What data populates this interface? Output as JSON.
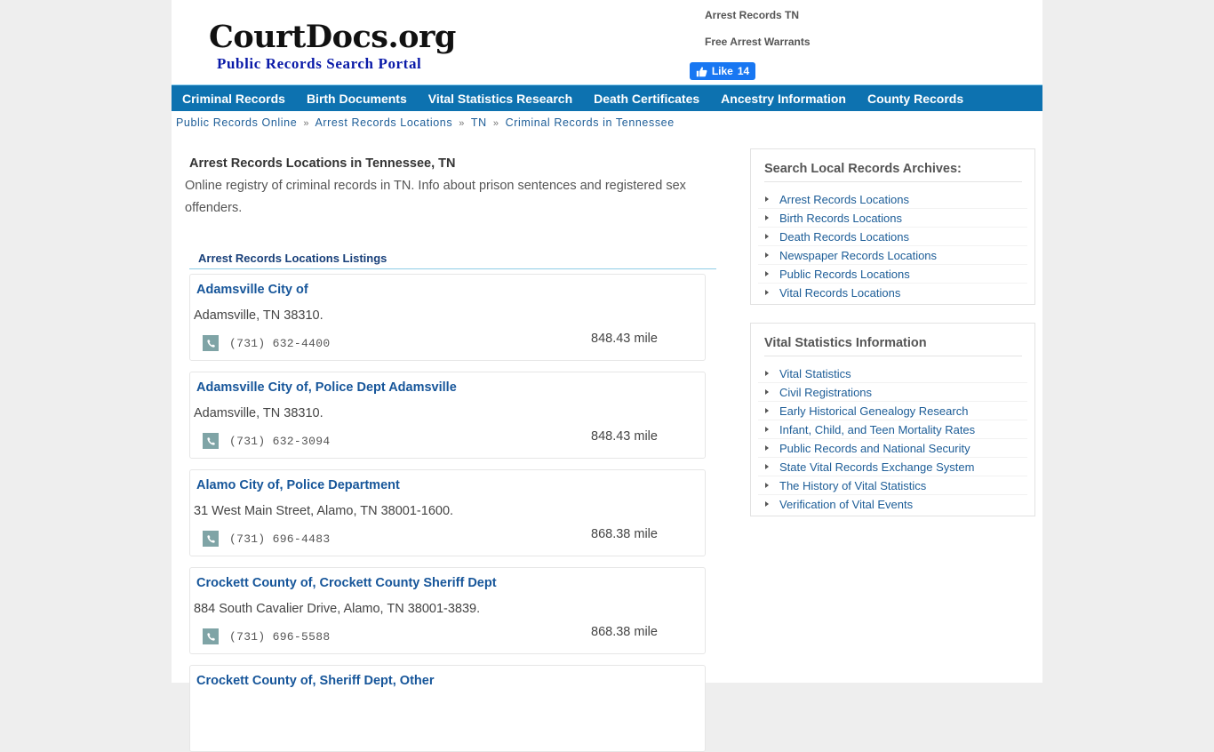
{
  "header": {
    "logo_title": "CourtDocs.org",
    "logo_subtitle": "Public Records Search Portal",
    "top_links": [
      "Arrest Records TN",
      "Free Arrest Warrants"
    ],
    "fb_like": {
      "label": "Like",
      "count": "14",
      "color": "#1877f2"
    }
  },
  "nav": {
    "color": "#0d72b0",
    "items": [
      "Criminal Records",
      "Birth Documents",
      "Vital Statistics Research",
      "Death Certificates",
      "Ancestry Information",
      "County Records"
    ]
  },
  "breadcrumb": {
    "separator": "»",
    "items": [
      "Public Records Online",
      "Arrest Records Locations",
      "TN",
      "Criminal Records in Tennessee"
    ]
  },
  "main": {
    "title": "Arrest Records Locations in Tennessee, TN",
    "description": "Online registry of criminal records in TN. Info about prison sentences and registered sex offenders.",
    "listings_heading": "Arrest Records Locations Listings",
    "listings": [
      {
        "name": "Adamsville City of",
        "address": "Adamsville, TN 38310.",
        "phone": "(731) 632-4400",
        "distance": "848.43 mile"
      },
      {
        "name": "Adamsville City of, Police Dept Adamsville",
        "address": "Adamsville, TN 38310.",
        "phone": "(731) 632-3094",
        "distance": "848.43 mile"
      },
      {
        "name": "Alamo City of, Police Department",
        "address": "31 West Main Street, Alamo, TN 38001-1600.",
        "phone": "(731) 696-4483",
        "distance": "868.38 mile"
      },
      {
        "name": "Crockett County of, Crockett County Sheriff Dept",
        "address": "884 South Cavalier Drive, Alamo, TN 38001-3839.",
        "phone": "(731) 696-5588",
        "distance": "868.38 mile"
      },
      {
        "name": "Crockett County of, Sheriff Dept, Other"
      }
    ]
  },
  "sidebar": {
    "boxes": [
      {
        "title": "Search Local Records Archives:",
        "items": [
          "Arrest Records Locations",
          "Birth Records Locations",
          "Death Records Locations",
          "Newspaper Records Locations",
          "Public Records Locations",
          "Vital Records Locations"
        ]
      },
      {
        "title": "Vital Statistics Information",
        "items": [
          "Vital Statistics",
          "Civil Registrations",
          "Early Historical Genealogy Research",
          "Infant, Child, and Teen Mortality Rates",
          "Public Records and National Security",
          "State Vital Records Exchange System",
          "The History of Vital Statistics",
          "Verification of Vital Events"
        ]
      }
    ]
  }
}
